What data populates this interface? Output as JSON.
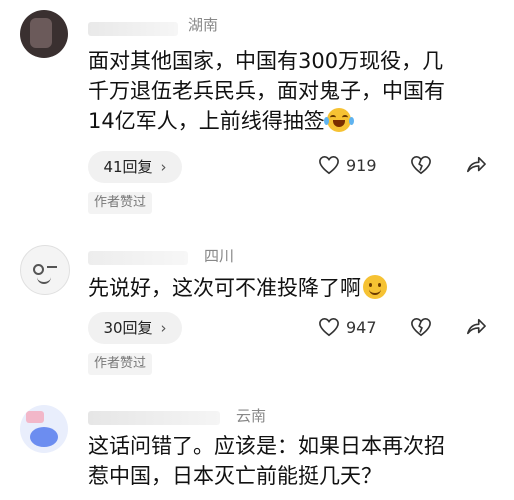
{
  "comments": [
    {
      "region": "湖南",
      "text_lines": [
        "面对其他国家，中国有300万现役，几",
        "千万退伍老兵民兵，面对鬼子，中国有",
        "14亿军人，上前线得抽签"
      ],
      "emoji": "laughing-crying-emoji",
      "replies_label": "41回复",
      "likes": "919",
      "badge": "作者赞过"
    },
    {
      "region": "四川",
      "text_lines": [
        "先说好，这次可不准投降了啊"
      ],
      "emoji": "smile-emoji",
      "replies_label": "30回复",
      "likes": "947",
      "badge": "作者赞过"
    },
    {
      "region": "云南",
      "text_lines": [
        "这话问错了。应该是：如果日本再次招",
        "惹中国，日本灭亡前能挺几天？"
      ]
    }
  ],
  "colors": {
    "accent_emoji": "#f6c233",
    "muted": "#888888",
    "pill_bg": "#f1f1f1"
  },
  "icons": [
    "heart-icon",
    "broken-heart-icon",
    "share-icon",
    "chevron-right-icon"
  ]
}
